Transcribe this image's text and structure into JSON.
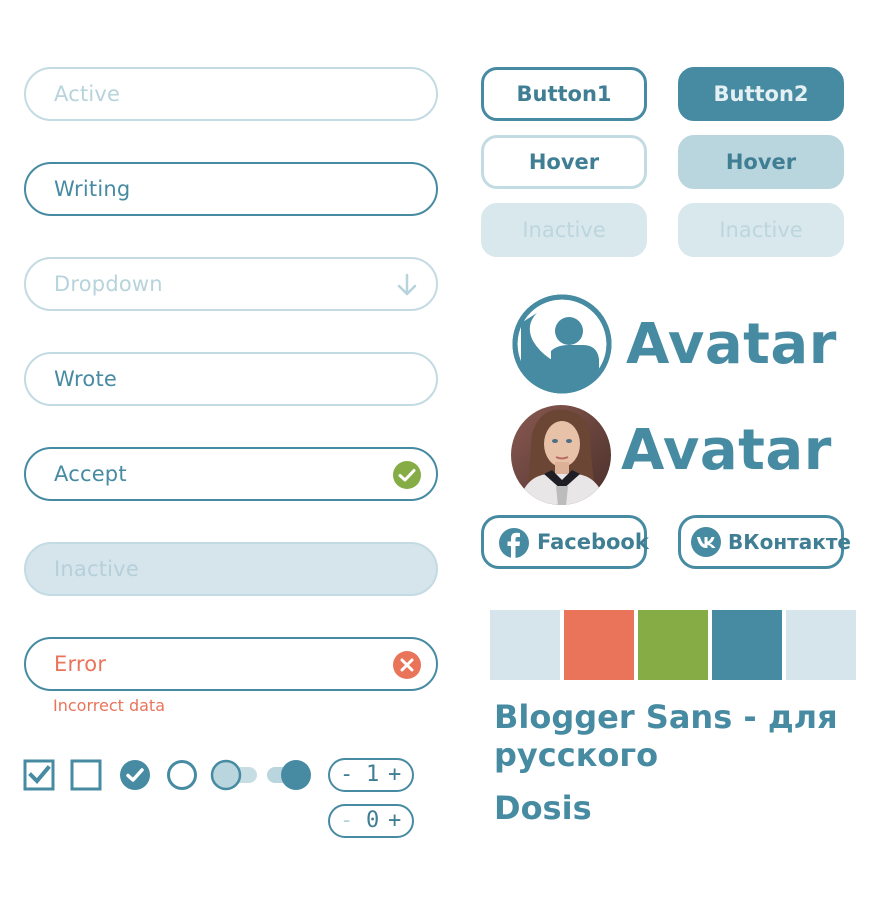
{
  "inputs": {
    "active": {
      "placeholder": "Active"
    },
    "writing": {
      "value": "Writing"
    },
    "dropdown": {
      "placeholder": "Dropdown",
      "icon": "arrow-down-icon"
    },
    "wrote": {
      "value": "Wrote"
    },
    "accept": {
      "value": "Accept",
      "icon": "check-circle-icon"
    },
    "inactive": {
      "placeholder": "Inactive"
    },
    "error": {
      "value": "Error",
      "icon": "x-circle-icon",
      "message": "Incorrect data"
    }
  },
  "buttons": {
    "button1": "Button1",
    "button2": "Button2",
    "hover_outline": "Hover",
    "hover_filled": "Hover",
    "inactive_outline": "Inactive",
    "inactive_filled": "Inactive"
  },
  "avatars": {
    "icon_label": "Avatar",
    "photo_label": "Avatar"
  },
  "social": {
    "facebook": "Facebook",
    "vkontakte": "ВКонтакте"
  },
  "palette": [
    "#d5e5eb",
    "#e9745a",
    "#86ac45",
    "#468ba2",
    "#d5e5eb"
  ],
  "typography": {
    "line1": "Blogger Sans - для",
    "line2": "русского",
    "line3": "Dosis"
  },
  "controls": {
    "checkbox_checked": true,
    "checkbox_unchecked": false,
    "radio_checked": true,
    "radio_unchecked": false,
    "toggle_off": false,
    "toggle_on": true,
    "stepper1": {
      "minus": "-",
      "value": "1",
      "plus": "+"
    },
    "stepper2": {
      "minus": "-",
      "value": "0",
      "plus": "+"
    }
  },
  "colors": {
    "accent": "#468ba2",
    "light": "#d5e5eb",
    "error": "#e9745a",
    "success": "#86ac45"
  }
}
